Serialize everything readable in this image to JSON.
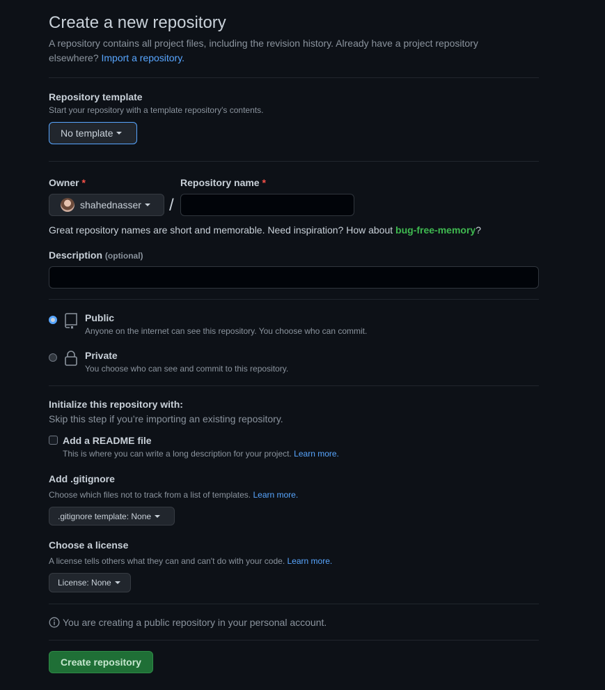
{
  "header": {
    "title": "Create a new repository",
    "subtitle_line1": "A repository contains all project files, including the revision history. Already have a project repository",
    "subtitle_line2": "elsewhere?",
    "import_link": "Import a repository."
  },
  "template": {
    "label": "Repository template",
    "help": "Start your repository with a template repository's contents.",
    "button": "No template"
  },
  "owner": {
    "label": "Owner",
    "required_mark": "*",
    "value": "shahednasser",
    "separator": "/"
  },
  "repo_name": {
    "label": "Repository name",
    "required_mark": "*",
    "value": ""
  },
  "suggestion": {
    "text": "Great repository names are short and memorable. Need inspiration? How about",
    "name": "bug-free-memory",
    "end": "?"
  },
  "description": {
    "label": "Description",
    "optional": "(optional)",
    "value": ""
  },
  "visibility": {
    "public_label": "Public",
    "public_help": "Anyone on the internet can see this repository. You choose who can commit.",
    "private_label": "Private",
    "private_help": "You choose who can see and commit to this repository.",
    "selected": "public"
  },
  "init": {
    "heading": "Initialize this repository with:",
    "help": "Skip this step if you’re importing an existing repository.",
    "readme_label": "Add a README file",
    "readme_help": "This is where you can write a long description for your project.",
    "readme_checked": false,
    "learn_more": "Learn more."
  },
  "gitignore": {
    "label": "Add .gitignore",
    "help": "Choose which files not to track from a list of templates.",
    "learn_more": "Learn more.",
    "button": ".gitignore template: None"
  },
  "license": {
    "label": "Choose a license",
    "help": "A license tells others what they can and can't do with your code.",
    "learn_more": "Learn more.",
    "button": "License: None"
  },
  "notice": {
    "text": "You are creating a public repository in your personal account."
  },
  "submit": {
    "label": "Create repository"
  },
  "colors": {
    "accent": "#58a6ff",
    "primary_button": "#238636",
    "suggestion": "#3fb950"
  }
}
